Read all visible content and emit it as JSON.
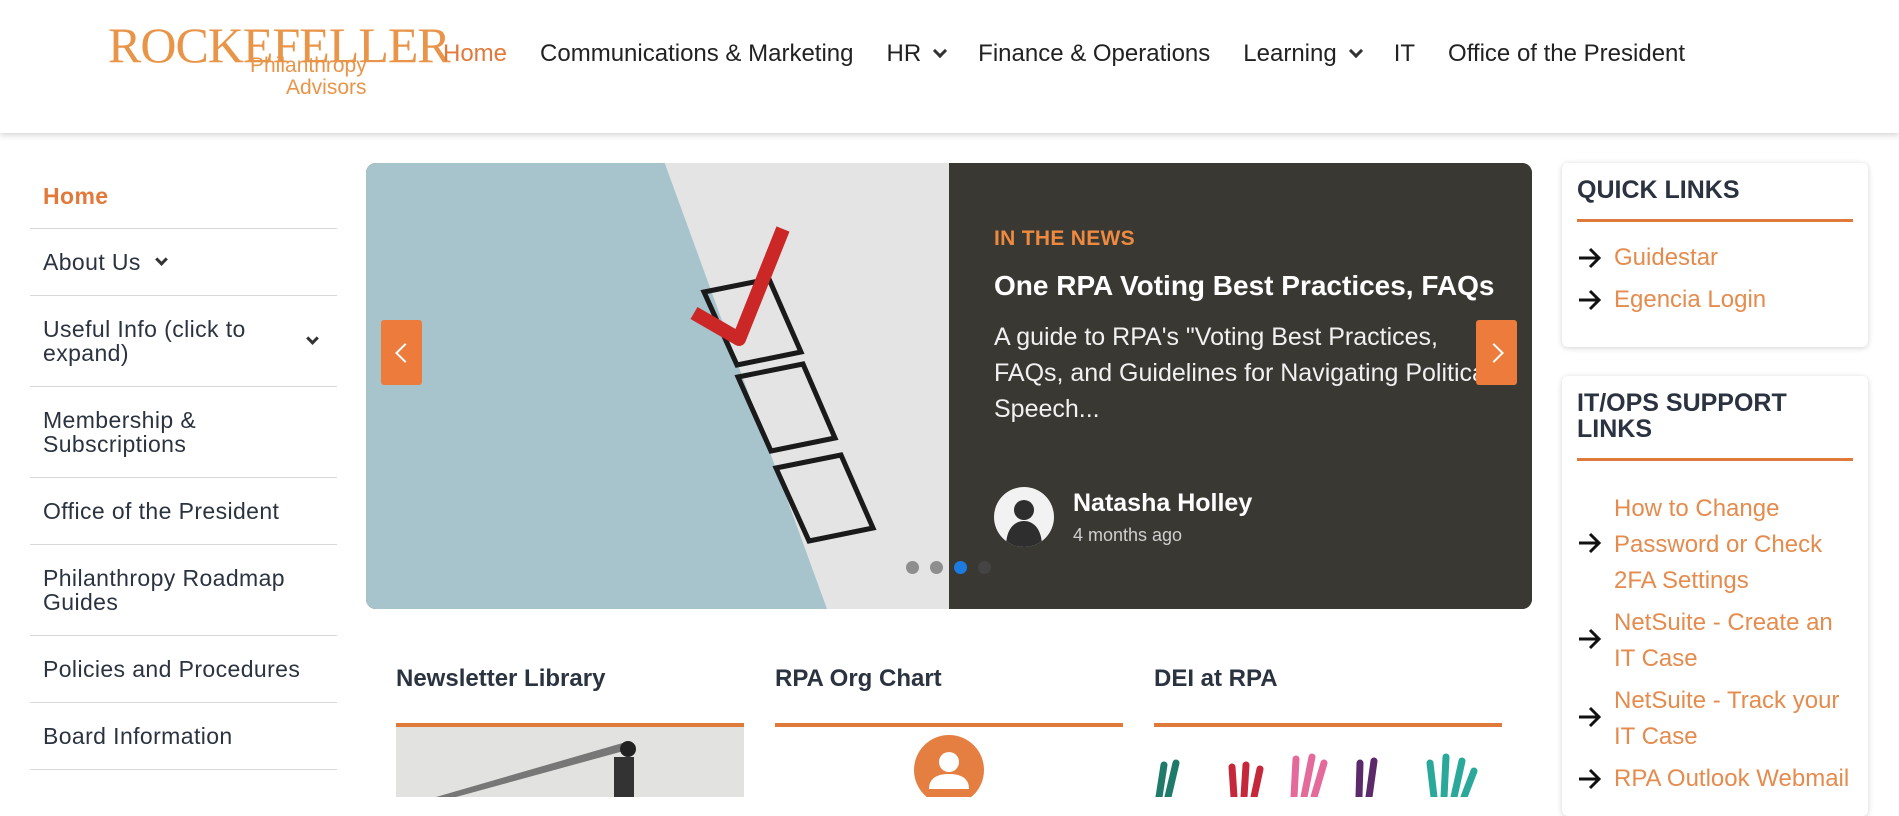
{
  "brand": {
    "logo_line1": "ROCKEFELLER",
    "logo_line2": "Philanthropy",
    "logo_line3": "Advisors",
    "accent_color": "#e2793a"
  },
  "topnav": {
    "items": [
      {
        "label": "Home",
        "active": true
      },
      {
        "label": "Communications & Marketing"
      },
      {
        "label": "HR",
        "dropdown": true
      },
      {
        "label": "Finance & Operations"
      },
      {
        "label": "Learning",
        "dropdown": true
      },
      {
        "label": "IT"
      },
      {
        "label": "Office of the President"
      }
    ]
  },
  "sidebar": {
    "items": [
      {
        "label": "Home",
        "active": true
      },
      {
        "label": "About Us",
        "dropdown": true
      },
      {
        "label": "Useful Info (click to expand)",
        "dropdown": true
      },
      {
        "label": "Membership & Subscriptions"
      },
      {
        "label": "Office of the President"
      },
      {
        "label": "Philanthropy Roadmap Guides"
      },
      {
        "label": "Policies and Procedures"
      },
      {
        "label": "Board Information"
      }
    ]
  },
  "carousel": {
    "kicker": "IN THE NEWS",
    "title": "One RPA Voting Best Practices, FAQs",
    "body": "A guide to RPA's \"Voting Best Practices, FAQs, and Guidelines for Navigating Political Speech...",
    "author": "Natasha Holley",
    "time": "4 months ago",
    "prev_icon": "chevron-left-icon",
    "next_icon": "chevron-right-icon",
    "slide_count": 4,
    "active_slide": 3
  },
  "cards": [
    {
      "title": "Newsletter Library"
    },
    {
      "title": "RPA Org Chart"
    },
    {
      "title": "DEI at RPA"
    }
  ],
  "quick_links": {
    "title": "QUICK LINKS",
    "links": [
      "Guidestar",
      "Egencia Login"
    ]
  },
  "support_links": {
    "title": "IT/OPS SUPPORT LINKS",
    "links": [
      "How to Change Password or Check 2FA Settings",
      "NetSuite - Create an IT Case",
      "NetSuite - Track your IT Case",
      "RPA Outlook Webmail"
    ]
  }
}
